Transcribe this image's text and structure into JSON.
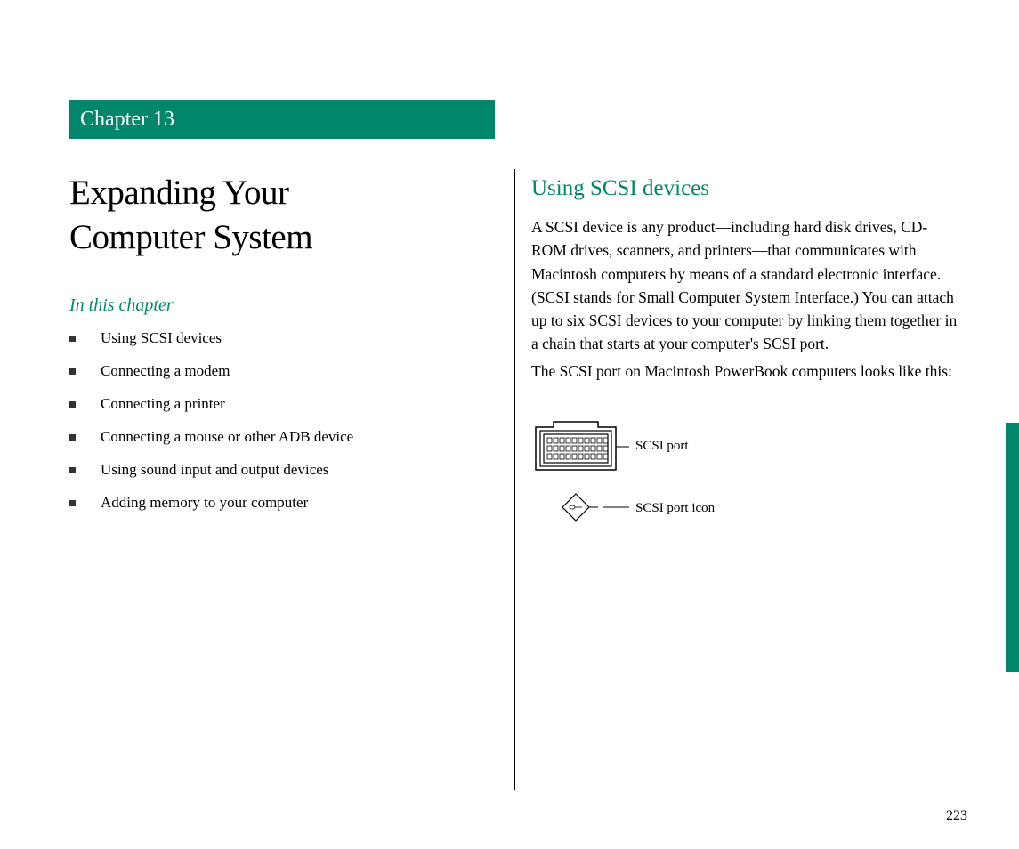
{
  "chapter": {
    "label": "Chapter 13",
    "title_line1": "Expanding Your",
    "title_line2": "Computer System"
  },
  "toc": {
    "heading": "In this chapter",
    "items": [
      "Using SCSI devices",
      "Connecting a modem",
      "Connecting a printer",
      "Connecting a mouse or other ADB device",
      "Using sound input and output devices",
      "Adding memory to your computer"
    ]
  },
  "section": {
    "heading": "Using SCSI devices",
    "para1": "A SCSI device is any product—including hard disk drives, CD-ROM drives, scanners, and printers—that communicates with Macintosh computers by means of a standard electronic interface. (SCSI stands for Small Computer System Interface.) You can attach up to six SCSI devices to your computer by linking them together in a chain that starts at your computer's SCSI port.",
    "para2": "The SCSI port on Macintosh PowerBook computers looks like this:"
  },
  "diagram": {
    "port_label": "SCSI port",
    "icon_label": "SCSI port icon"
  },
  "page_number": "223",
  "colors": {
    "accent": "#00876b"
  }
}
